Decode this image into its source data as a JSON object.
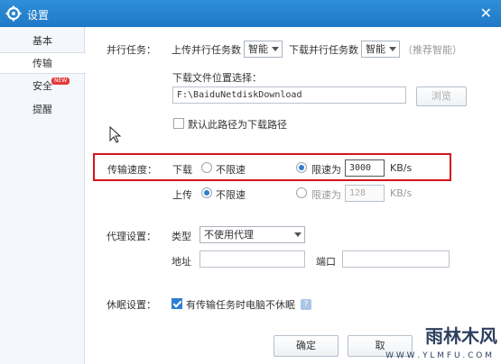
{
  "window": {
    "title": "设置",
    "close_glyph": "✕"
  },
  "sidebar": {
    "items": [
      {
        "label": "基本"
      },
      {
        "label": "传输"
      },
      {
        "label": "安全",
        "badge": "NEW"
      },
      {
        "label": "提醒"
      }
    ],
    "active_index": 1
  },
  "parallel": {
    "label": "并行任务：",
    "upload_label": "上传并行任务数",
    "upload_value": "智能",
    "download_label": "下载并行任务数",
    "download_value": "智能",
    "hint": "（推荐智能）"
  },
  "download_location": {
    "label": "下载文件位置选择：",
    "path": "F:\\BaiduNetdiskDownload",
    "browse_button": "浏览",
    "default_checkbox_label": "默认此路径为下载路径",
    "default_checked": false
  },
  "speed": {
    "label": "传输速度：",
    "download": {
      "label": "下载",
      "unlimited_label": "不限速",
      "limit_label": "限速为",
      "limit_value": "3000",
      "unit": "KB/s",
      "selected": "limit"
    },
    "upload": {
      "label": "上传",
      "unlimited_label": "不限速",
      "limit_label": "限速为",
      "limit_value": "128",
      "unit": "KB/s",
      "selected": "unlimited"
    }
  },
  "proxy": {
    "label": "代理设置：",
    "type_label": "类型",
    "type_value": "不使用代理",
    "address_label": "地址",
    "address_value": "",
    "port_label": "端口",
    "port_value": ""
  },
  "sleep": {
    "label": "休眠设置：",
    "checkbox_label": "有传输任务时电脑不休眠",
    "checked": true,
    "help_glyph": "?"
  },
  "footer": {
    "ok_button": "确定",
    "cancel_button": "取"
  },
  "watermark": {
    "logo": "雨林木风",
    "url": "W W W . Y L M F U . C O M"
  }
}
